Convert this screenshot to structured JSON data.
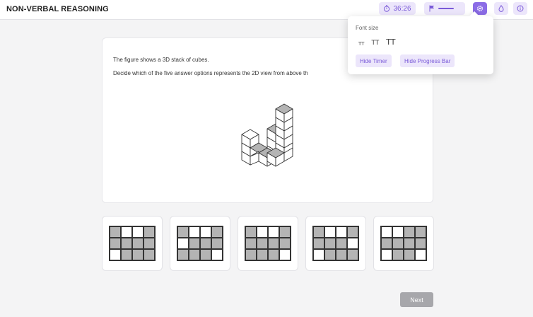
{
  "app": {
    "title": "NON-VERBAL REASONING"
  },
  "header": {
    "timer": "36:26"
  },
  "question": {
    "line1": "The figure shows a 3D stack of cubes.",
    "line2": "Decide which of the five answer options represents the 2D view from above th"
  },
  "options": [
    {
      "grid": [
        [
          1,
          0,
          0,
          1
        ],
        [
          1,
          1,
          1,
          1
        ],
        [
          0,
          1,
          1,
          1
        ]
      ]
    },
    {
      "grid": [
        [
          1,
          0,
          0,
          1
        ],
        [
          0,
          1,
          1,
          1
        ],
        [
          1,
          1,
          1,
          0
        ]
      ]
    },
    {
      "grid": [
        [
          1,
          0,
          0,
          1
        ],
        [
          1,
          1,
          1,
          1
        ],
        [
          1,
          1,
          1,
          0
        ]
      ]
    },
    {
      "grid": [
        [
          1,
          0,
          0,
          1
        ],
        [
          1,
          1,
          1,
          0
        ],
        [
          0,
          1,
          1,
          1
        ]
      ]
    },
    {
      "grid": [
        [
          0,
          0,
          1,
          1
        ],
        [
          1,
          1,
          1,
          1
        ],
        [
          0,
          1,
          1,
          0
        ]
      ]
    }
  ],
  "navigation": {
    "next_label": "Next"
  },
  "settings_popover": {
    "title": "Font size",
    "sizes": [
      "TT",
      "TT",
      "TT"
    ],
    "hide_timer_label": "Hide Timer",
    "hide_progress_label": "Hide Progress Bar"
  },
  "colors": {
    "accent": "#8b6ce6",
    "accent_light": "#ece6fb",
    "shade": "#b4b4b4"
  }
}
